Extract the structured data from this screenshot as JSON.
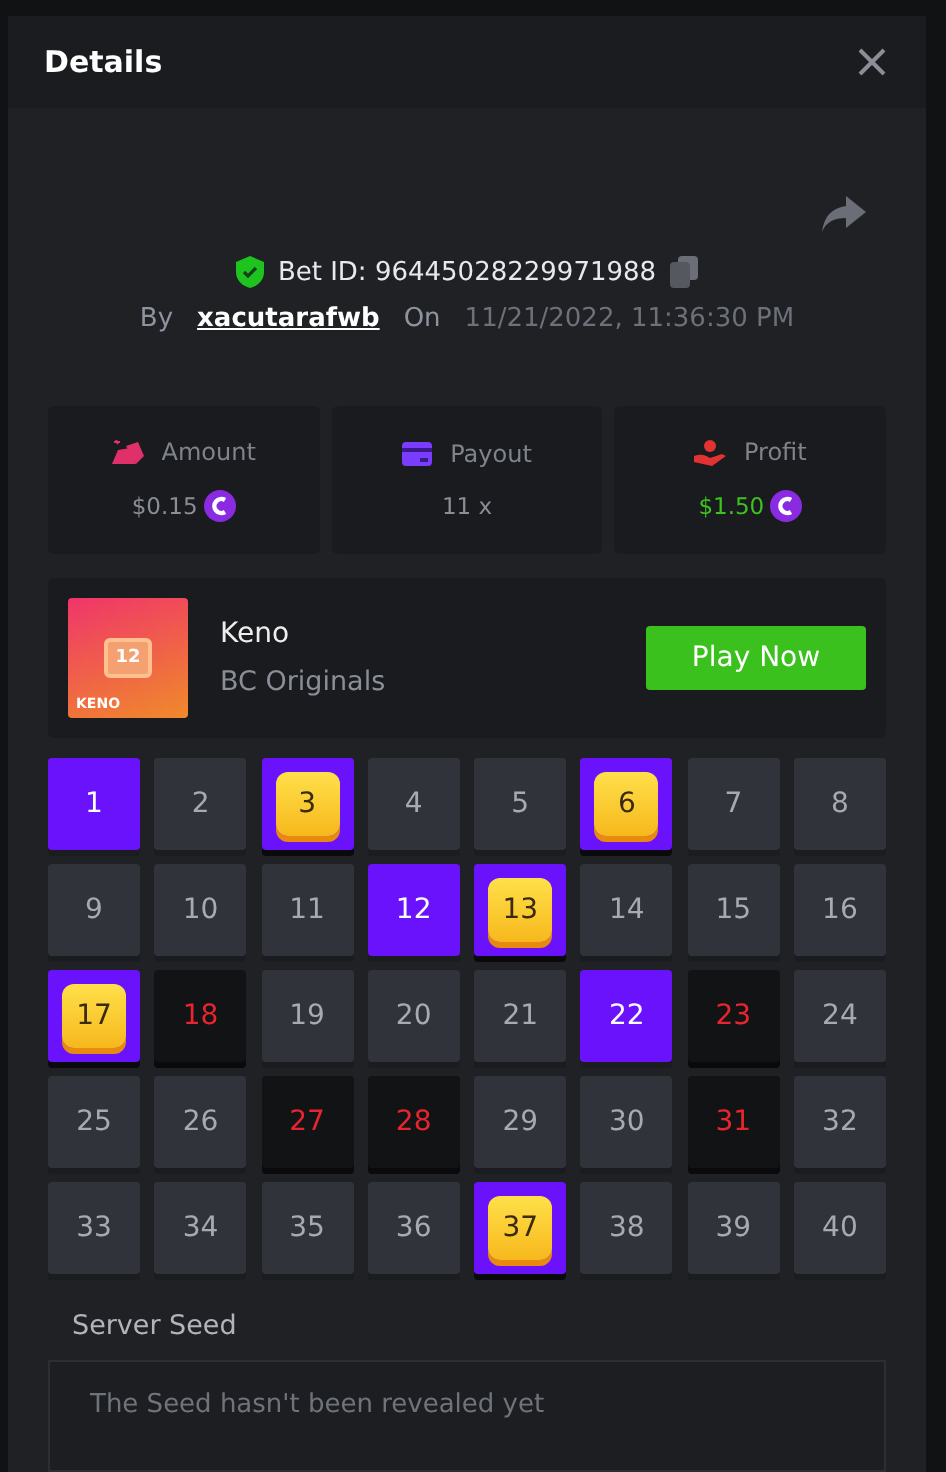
{
  "modal": {
    "title": "Details"
  },
  "bet": {
    "id_label": "Bet ID:",
    "id": "96445028229971988",
    "verified": true,
    "by_label": "By",
    "user": "xacutarafwb",
    "on_label": "On",
    "date": "11/21/2022, 11:36:30 PM"
  },
  "stats": [
    {
      "kind": "amount",
      "label": "Amount",
      "value": "$0.15",
      "coin": true,
      "win": false
    },
    {
      "kind": "payout",
      "label": "Payout",
      "value": "11 x",
      "coin": false,
      "win": false
    },
    {
      "kind": "profit",
      "label": "Profit",
      "value": "$1.50",
      "coin": true,
      "win": true
    }
  ],
  "game": {
    "name": "Keno",
    "provider": "BC Originals",
    "thumb_number": "12",
    "thumb_label": "KENO",
    "play_button": "Play Now"
  },
  "cells": [
    {
      "n": "1",
      "kind": "picked"
    },
    {
      "n": "2",
      "kind": "plain"
    },
    {
      "n": "3",
      "kind": "hit"
    },
    {
      "n": "4",
      "kind": "plain"
    },
    {
      "n": "5",
      "kind": "plain"
    },
    {
      "n": "6",
      "kind": "hit"
    },
    {
      "n": "7",
      "kind": "plain"
    },
    {
      "n": "8",
      "kind": "plain"
    },
    {
      "n": "9",
      "kind": "plain"
    },
    {
      "n": "10",
      "kind": "plain"
    },
    {
      "n": "11",
      "kind": "plain"
    },
    {
      "n": "12",
      "kind": "picked"
    },
    {
      "n": "13",
      "kind": "hit"
    },
    {
      "n": "14",
      "kind": "plain"
    },
    {
      "n": "15",
      "kind": "plain"
    },
    {
      "n": "16",
      "kind": "plain"
    },
    {
      "n": "17",
      "kind": "hit"
    },
    {
      "n": "18",
      "kind": "drawn"
    },
    {
      "n": "19",
      "kind": "plain"
    },
    {
      "n": "20",
      "kind": "plain"
    },
    {
      "n": "21",
      "kind": "plain"
    },
    {
      "n": "22",
      "kind": "picked"
    },
    {
      "n": "23",
      "kind": "drawn"
    },
    {
      "n": "24",
      "kind": "plain"
    },
    {
      "n": "25",
      "kind": "plain"
    },
    {
      "n": "26",
      "kind": "plain"
    },
    {
      "n": "27",
      "kind": "drawn"
    },
    {
      "n": "28",
      "kind": "drawn"
    },
    {
      "n": "29",
      "kind": "plain"
    },
    {
      "n": "30",
      "kind": "plain"
    },
    {
      "n": "31",
      "kind": "drawn"
    },
    {
      "n": "32",
      "kind": "plain"
    },
    {
      "n": "33",
      "kind": "plain"
    },
    {
      "n": "34",
      "kind": "plain"
    },
    {
      "n": "35",
      "kind": "plain"
    },
    {
      "n": "36",
      "kind": "plain"
    },
    {
      "n": "37",
      "kind": "hit"
    },
    {
      "n": "38",
      "kind": "plain"
    },
    {
      "n": "39",
      "kind": "plain"
    },
    {
      "n": "40",
      "kind": "plain"
    }
  ],
  "server_seed": {
    "label": "Server Seed",
    "value": "The Seed hasn't been revealed yet"
  }
}
